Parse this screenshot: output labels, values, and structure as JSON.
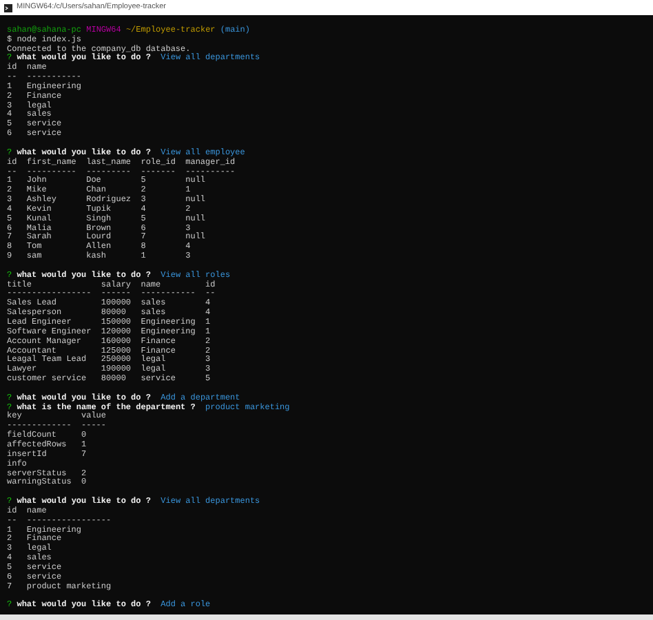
{
  "window": {
    "title": "MINGW64:/c/Users/sahan/Employee-tracker"
  },
  "lines": [
    {
      "kind": "blank"
    },
    {
      "kind": "shell_prompt",
      "user": "sahan@sahana-pc",
      "shell": "MINGW64",
      "path": "~/Employee-tracker",
      "branch": "(main)"
    },
    {
      "kind": "command",
      "text": "$ node index.js"
    },
    {
      "kind": "text",
      "text": "Connected to the company_db database."
    },
    {
      "kind": "question",
      "mark": "?",
      "question": "what would you like to do ?",
      "answer": "View all departments"
    },
    {
      "kind": "text",
      "text": "id  name"
    },
    {
      "kind": "text",
      "text": "--  -----------"
    },
    {
      "kind": "text",
      "text": "1   Engineering"
    },
    {
      "kind": "text",
      "text": "2   Finance"
    },
    {
      "kind": "text",
      "text": "3   legal"
    },
    {
      "kind": "text",
      "text": "4   sales"
    },
    {
      "kind": "text",
      "text": "5   service"
    },
    {
      "kind": "text",
      "text": "6   service"
    },
    {
      "kind": "blank"
    },
    {
      "kind": "question",
      "mark": "?",
      "question": "what would you like to do ?",
      "answer": "View all employee"
    },
    {
      "kind": "text",
      "text": "id  first_name  last_name  role_id  manager_id"
    },
    {
      "kind": "text",
      "text": "--  ----------  ---------  -------  ----------"
    },
    {
      "kind": "text",
      "text": "1   John        Doe        5        null"
    },
    {
      "kind": "text",
      "text": "2   Mike        Chan       2        1"
    },
    {
      "kind": "text",
      "text": "3   Ashley      Rodriguez  3        null"
    },
    {
      "kind": "text",
      "text": "4   Kevin       Tupik      4        2"
    },
    {
      "kind": "text",
      "text": "5   Kunal       Singh      5        null"
    },
    {
      "kind": "text",
      "text": "6   Malia       Brown      6        3"
    },
    {
      "kind": "text",
      "text": "7   Sarah       Lourd      7        null"
    },
    {
      "kind": "text",
      "text": "8   Tom         Allen      8        4"
    },
    {
      "kind": "text",
      "text": "9   sam         kash       1        3"
    },
    {
      "kind": "blank"
    },
    {
      "kind": "question",
      "mark": "?",
      "question": "what would you like to do ?",
      "answer": "View all roles"
    },
    {
      "kind": "text",
      "text": "title              salary  name         id"
    },
    {
      "kind": "text",
      "text": "-----------------  ------  -----------  --"
    },
    {
      "kind": "text",
      "text": "Sales Lead         100000  sales        4"
    },
    {
      "kind": "text",
      "text": "Salesperson        80000   sales        4"
    },
    {
      "kind": "text",
      "text": "Lead Engineer      150000  Engineering  1"
    },
    {
      "kind": "text",
      "text": "Software Engineer  120000  Engineering  1"
    },
    {
      "kind": "text",
      "text": "Account Manager    160000  Finance      2"
    },
    {
      "kind": "text",
      "text": "Accountant         125000  Finance      2"
    },
    {
      "kind": "text",
      "text": "Leagal Team Lead   250000  legal        3"
    },
    {
      "kind": "text",
      "text": "Lawyer             190000  legal        3"
    },
    {
      "kind": "text",
      "text": "customer service   80000   service      5"
    },
    {
      "kind": "blank"
    },
    {
      "kind": "question",
      "mark": "?",
      "question": "what would you like to do ?",
      "answer": "Add a department"
    },
    {
      "kind": "question",
      "mark": "?",
      "question": "what is the name of the department ?",
      "answer": "product marketing"
    },
    {
      "kind": "text",
      "text": "key            value"
    },
    {
      "kind": "text",
      "text": "-------------  -----"
    },
    {
      "kind": "text",
      "text": "fieldCount     0"
    },
    {
      "kind": "text",
      "text": "affectedRows   1"
    },
    {
      "kind": "text",
      "text": "insertId       7"
    },
    {
      "kind": "text",
      "text": "info"
    },
    {
      "kind": "text",
      "text": "serverStatus   2"
    },
    {
      "kind": "text",
      "text": "warningStatus  0"
    },
    {
      "kind": "blank"
    },
    {
      "kind": "question",
      "mark": "?",
      "question": "what would you like to do ?",
      "answer": "View all departments"
    },
    {
      "kind": "text",
      "text": "id  name"
    },
    {
      "kind": "text",
      "text": "--  -----------------"
    },
    {
      "kind": "text",
      "text": "1   Engineering"
    },
    {
      "kind": "text",
      "text": "2   Finance"
    },
    {
      "kind": "text",
      "text": "3   legal"
    },
    {
      "kind": "text",
      "text": "4   sales"
    },
    {
      "kind": "text",
      "text": "5   service"
    },
    {
      "kind": "text",
      "text": "6   service"
    },
    {
      "kind": "text",
      "text": "7   product marketing"
    },
    {
      "kind": "blank"
    },
    {
      "kind": "question",
      "mark": "?",
      "question": "what would you like to do ?",
      "answer": "Add a role"
    }
  ]
}
